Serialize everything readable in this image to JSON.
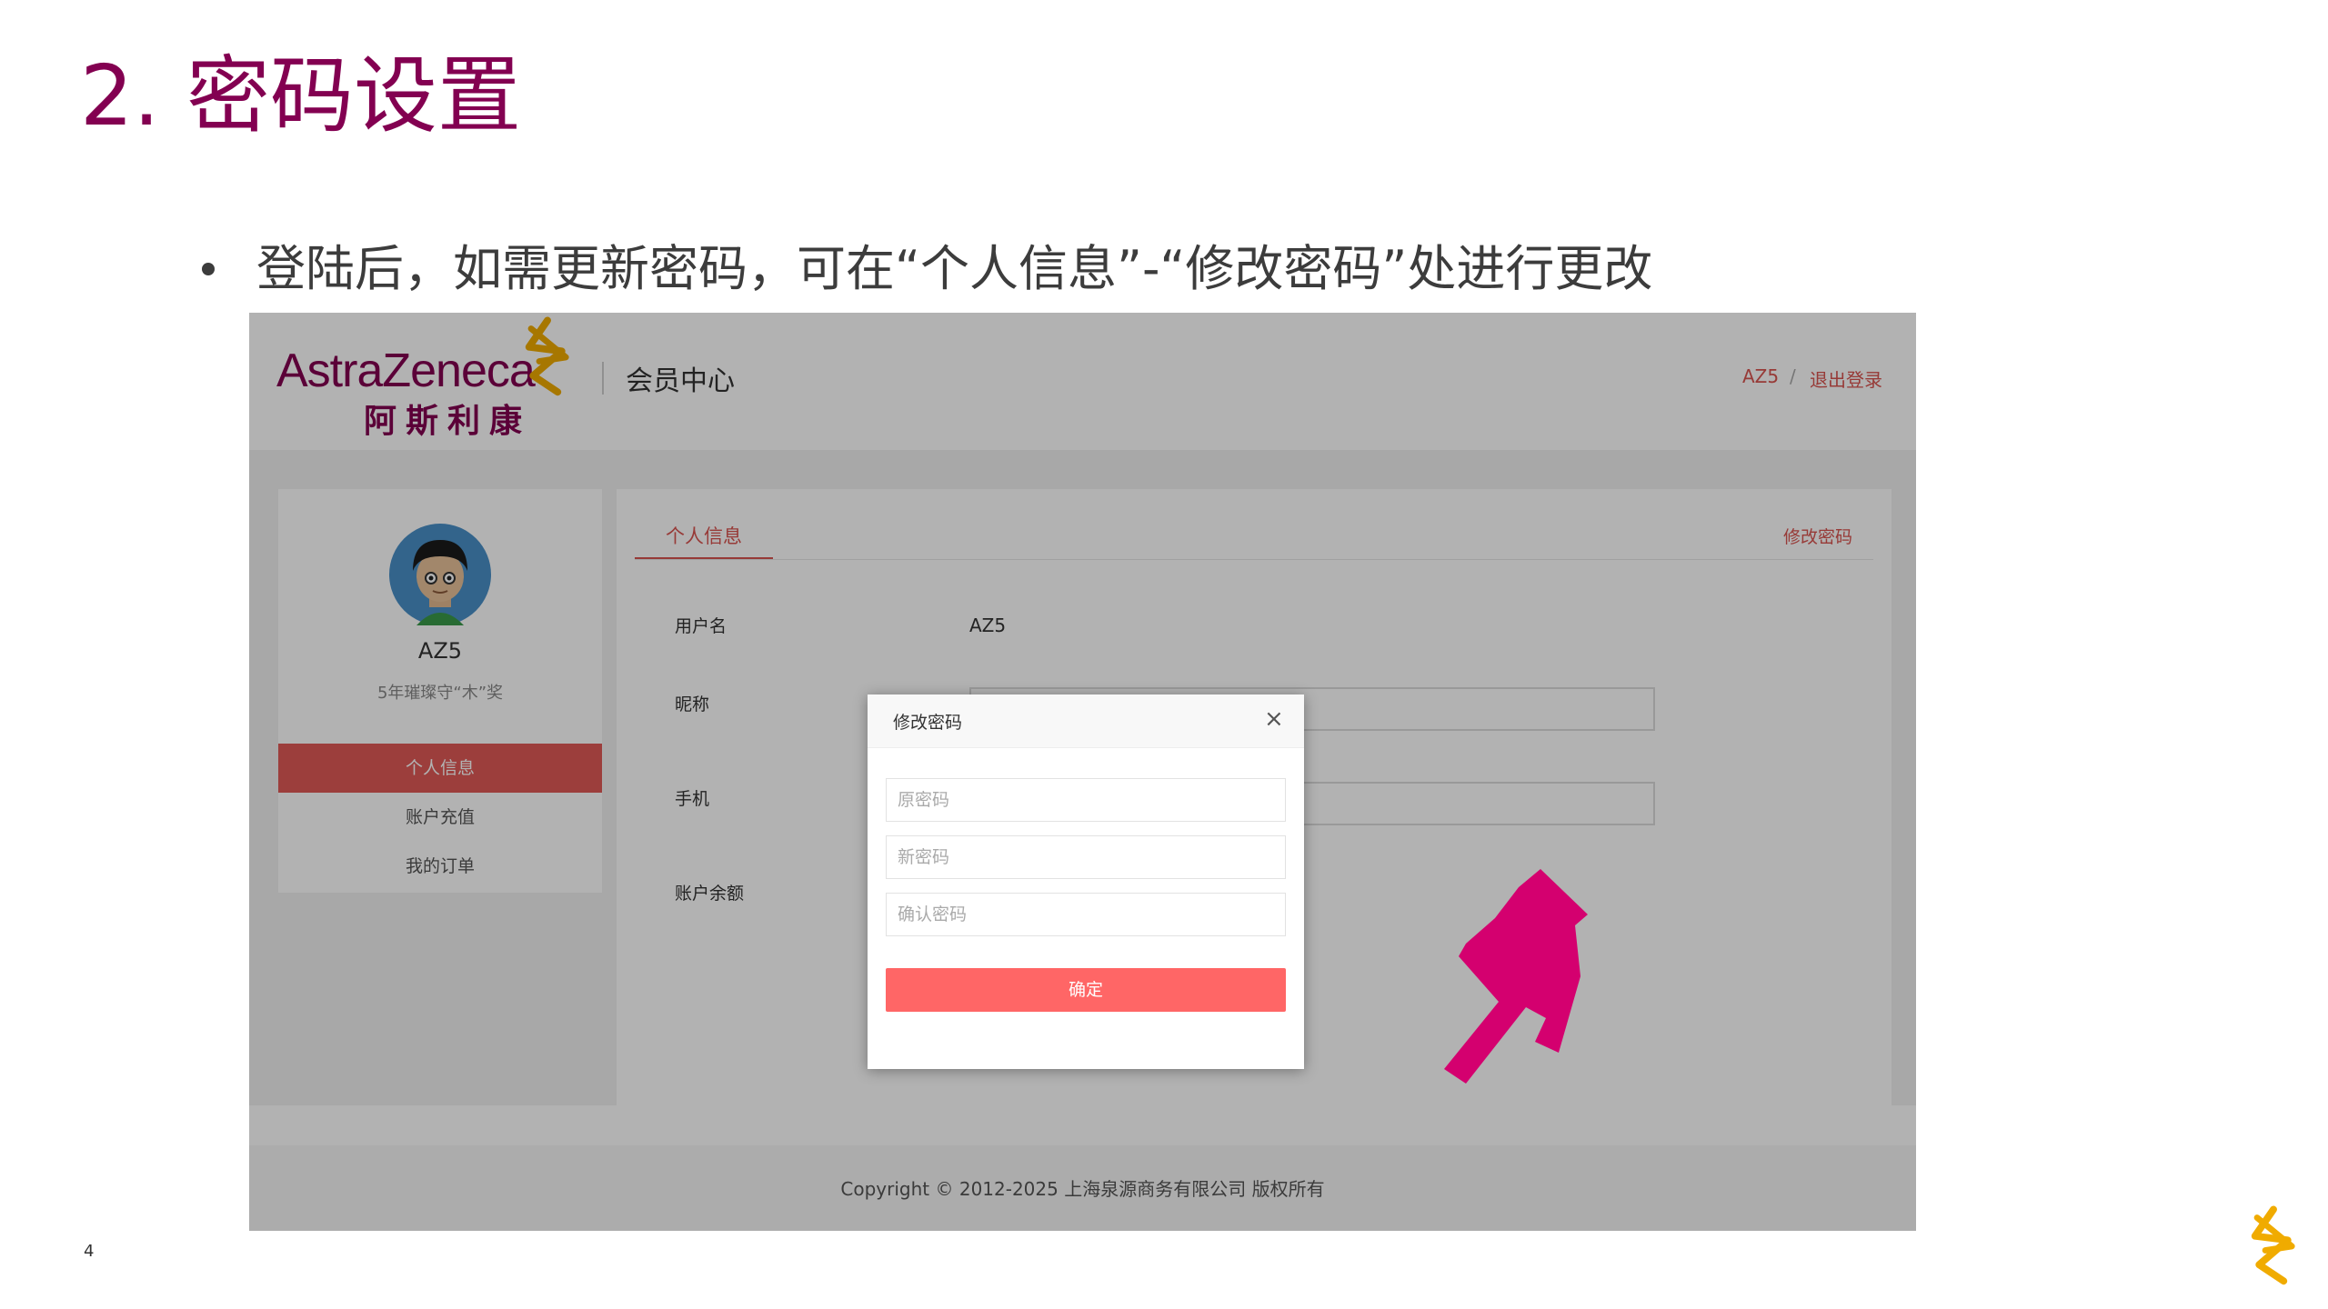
{
  "slide": {
    "title": "2. 密码设置",
    "bullet": "登陆后，如需更新密码，可在“个人信息”-“修改密码”处进行更改",
    "page_number": "4"
  },
  "site": {
    "brand_en": "AstraZeneca",
    "brand_cn": "阿斯利康",
    "section": "会员中心",
    "user": "AZ5",
    "separator": "/",
    "logout": "退出登录"
  },
  "profile": {
    "name": "AZ5",
    "motto": "5年璀璨守“木”奖",
    "menu": [
      "个人信息",
      "账户充值",
      "我的订单"
    ],
    "active_menu": "个人信息"
  },
  "panel": {
    "tab": "个人信息",
    "change_password_link": "修改密码",
    "fields": [
      {
        "label": "用户名",
        "value": "AZ5"
      },
      {
        "label": "昵称",
        "value": ""
      },
      {
        "label": "手机",
        "value": ""
      },
      {
        "label": "账户余额",
        "value": ""
      }
    ]
  },
  "modal": {
    "title": "修改密码",
    "close": "×",
    "old_password_placeholder": "原密码",
    "new_password_placeholder": "新密码",
    "confirm_password_placeholder": "确认密码",
    "confirm_label": "确定"
  },
  "footer": {
    "copyright": "Copyright © 2012-2025 上海泉源商务有限公司 版权所有"
  },
  "colors": {
    "brand": "#830051",
    "accent_red": "#d9534f",
    "confirm_button": "#ff6666",
    "pointer_hand": "#d4006f",
    "logo_gold": "#f0ab00"
  },
  "icons": {
    "brand_logo": "astrazeneca-helix-icon",
    "pointer": "pointing-hand-icon",
    "avatar": "cartoon-avatar"
  }
}
